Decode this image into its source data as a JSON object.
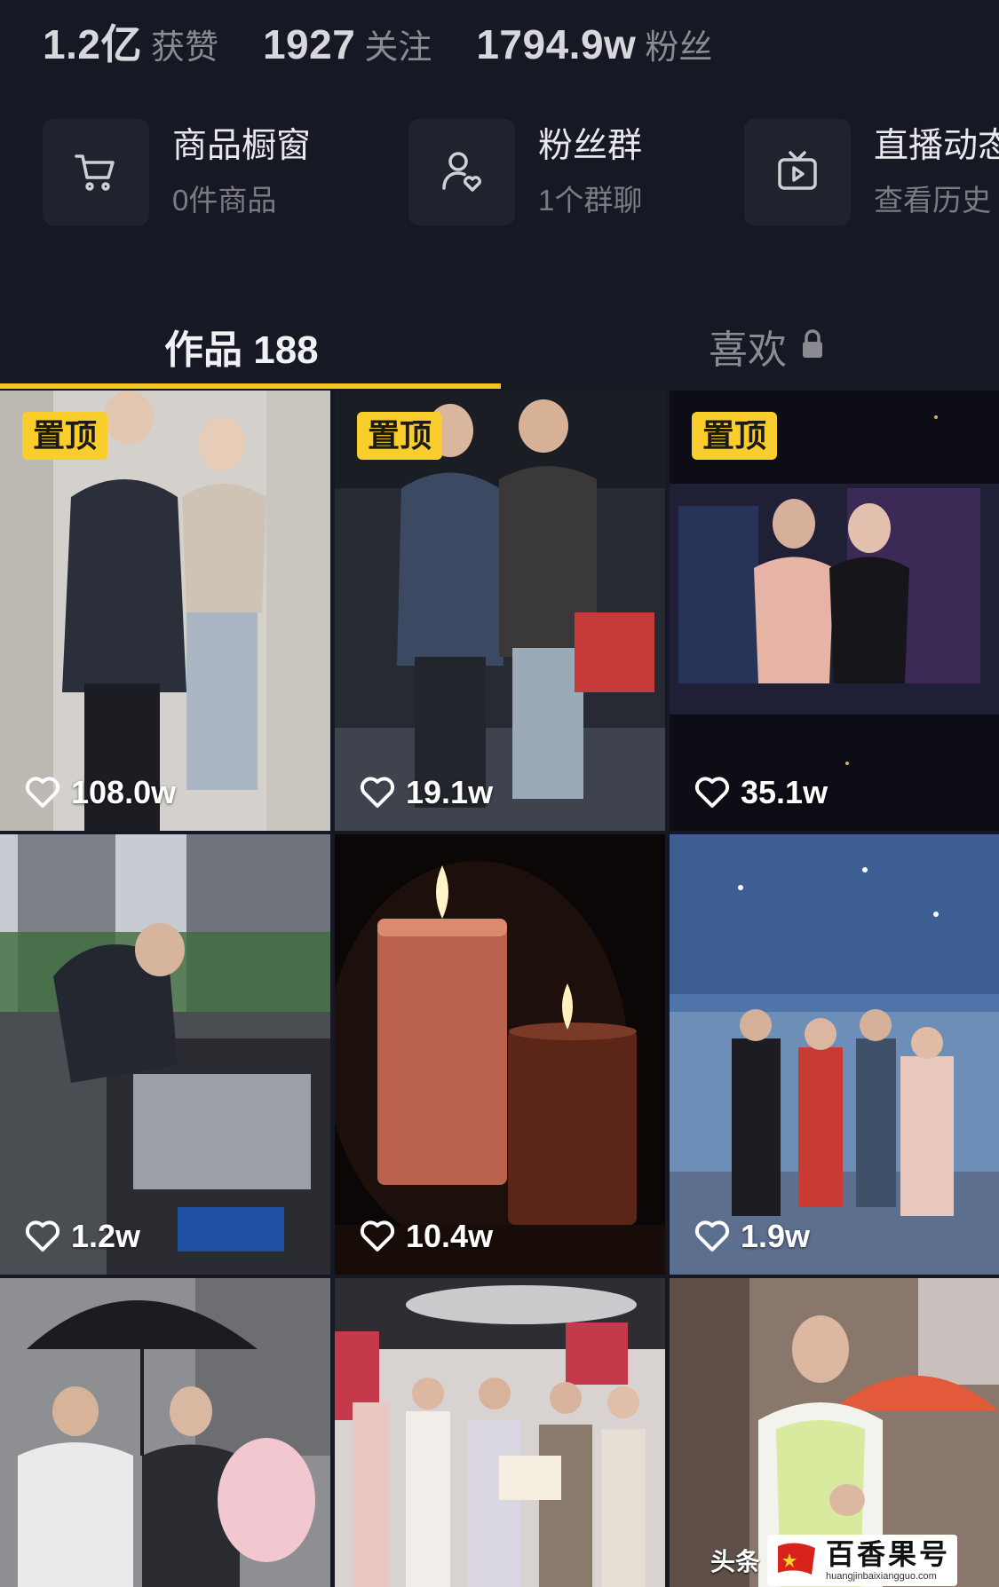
{
  "stats": [
    {
      "value": "1.2亿",
      "label": "获赞"
    },
    {
      "value": "1927",
      "label": "关注"
    },
    {
      "value": "1794.9w",
      "label": "粉丝"
    }
  ],
  "shortcuts": [
    {
      "title": "商品橱窗",
      "subtitle": "0件商品",
      "icon": "cart-icon"
    },
    {
      "title": "粉丝群",
      "subtitle": "1个群聊",
      "icon": "fan-group-icon"
    },
    {
      "title": "直播动态",
      "subtitle": "查看历史",
      "icon": "live-tv-icon"
    }
  ],
  "tabs": {
    "works": {
      "label": "作品 188"
    },
    "likes": {
      "label": "喜欢"
    }
  },
  "videos": [
    {
      "pinned": true,
      "pin_label": "置顶",
      "likes": "108.0w",
      "scene": "two people shaking hands in white room",
      "palette": [
        "#d8d6d2",
        "#b3b0ab"
      ]
    },
    {
      "pinned": true,
      "pin_label": "置顶",
      "likes": "19.1w",
      "scene": "two men shaking hands in dark studio",
      "palette": [
        "#2c2f3a",
        "#545a66"
      ]
    },
    {
      "pinned": true,
      "pin_label": "置顶",
      "likes": "35.1w",
      "scene": "couple posing before neon city backdrop",
      "palette": [
        "#0c0d16",
        "#3a2f53"
      ]
    },
    {
      "pinned": false,
      "likes": "1.2w",
      "scene": "man polishing luxury car emblem",
      "palette": [
        "#9aa3ad",
        "#3d4246"
      ]
    },
    {
      "pinned": false,
      "likes": "10.4w",
      "scene": "two candles burning in dark",
      "palette": [
        "#0c0605",
        "#3a1d12"
      ]
    },
    {
      "pinned": false,
      "likes": "1.9w",
      "scene": "four people on stage under starry dome",
      "palette": [
        "#6a8fc0",
        "#3a5a88"
      ]
    },
    {
      "pinned": false,
      "likes": "",
      "scene": "men under umbrella with flowers",
      "palette": [
        "#8d8e90",
        "#4a4b4e"
      ]
    },
    {
      "pinned": false,
      "likes": "",
      "scene": "group holding certificate in store",
      "palette": [
        "#d9d4d2",
        "#7b7072"
      ]
    },
    {
      "pinned": false,
      "likes": "",
      "scene": "man giving thumbs up outdoors",
      "palette": [
        "#b9a59b",
        "#6b5d55"
      ]
    }
  ],
  "watermark": {
    "left_text": "头条",
    "brand": "百香果号",
    "url": "huangjinbaixiangguo.com"
  },
  "colors": {
    "background": "#161823",
    "accent_yellow": "#f9c31a",
    "pin_yellow": "#f8cd2c",
    "muted_text": "#8a8b91"
  }
}
